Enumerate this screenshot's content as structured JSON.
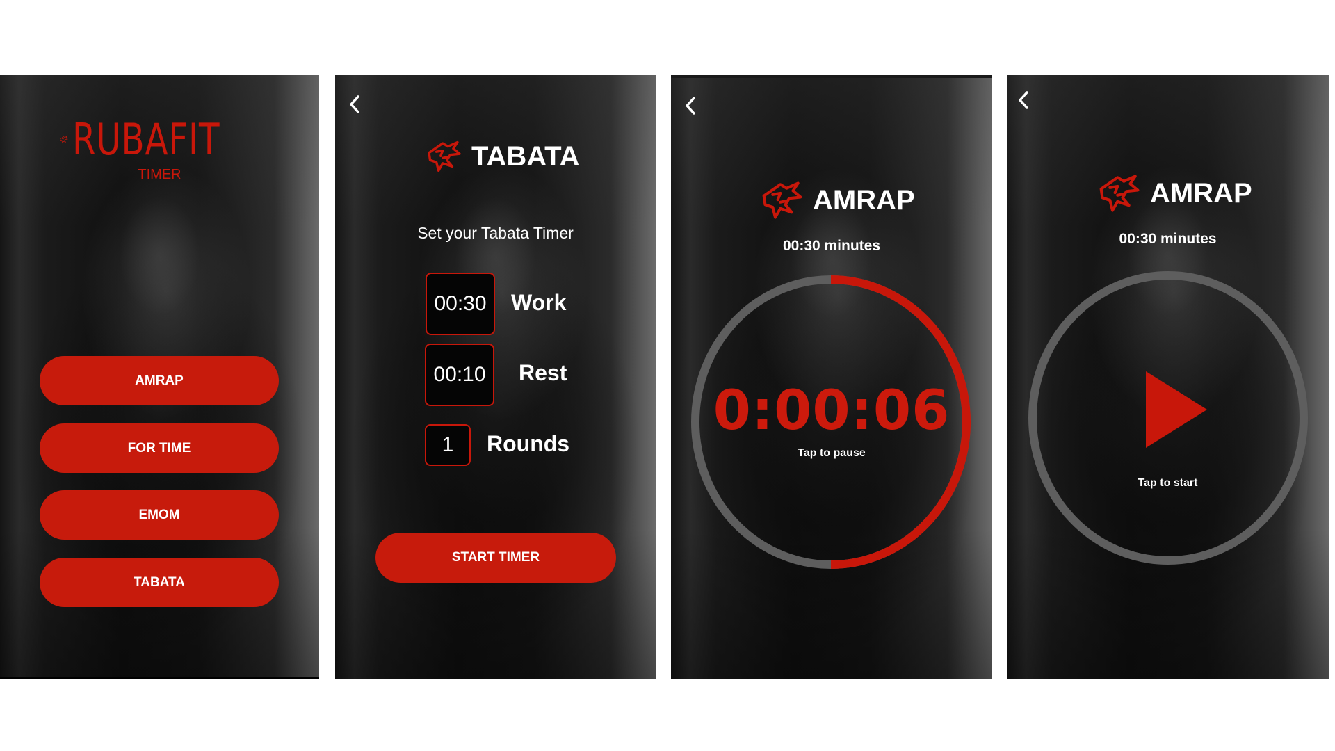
{
  "colors": {
    "accent": "#c71b0c",
    "text": "#ffffff",
    "ring_track": "#5e5e5e"
  },
  "home": {
    "brand_name": "RUBAFIT",
    "brand_sub": "TIMER",
    "logo_icon": "wolf-head-icon",
    "menu": [
      {
        "label": "AMRAP"
      },
      {
        "label": "FOR TIME"
      },
      {
        "label": "EMOM"
      },
      {
        "label": "TABATA"
      }
    ]
  },
  "tabata": {
    "back_icon": "chevron-left-icon",
    "title": "TABATA",
    "subtitle": "Set your Tabata Timer",
    "work": {
      "value": "00:30",
      "label": "Work"
    },
    "rest": {
      "value": "00:10",
      "label": "Rest"
    },
    "rounds": {
      "value": "1",
      "label": "Rounds"
    },
    "start_label": "START TIMER"
  },
  "amrap_running": {
    "back_icon": "chevron-left-icon",
    "title": "AMRAP",
    "duration": "00:30 minutes",
    "time": "0:00:06",
    "hint": "Tap to pause",
    "progress": 0.5
  },
  "amrap_ready": {
    "back_icon": "chevron-left-icon",
    "title": "AMRAP",
    "duration": "00:30 minutes",
    "hint": "Tap to start",
    "play_icon": "play-icon"
  }
}
